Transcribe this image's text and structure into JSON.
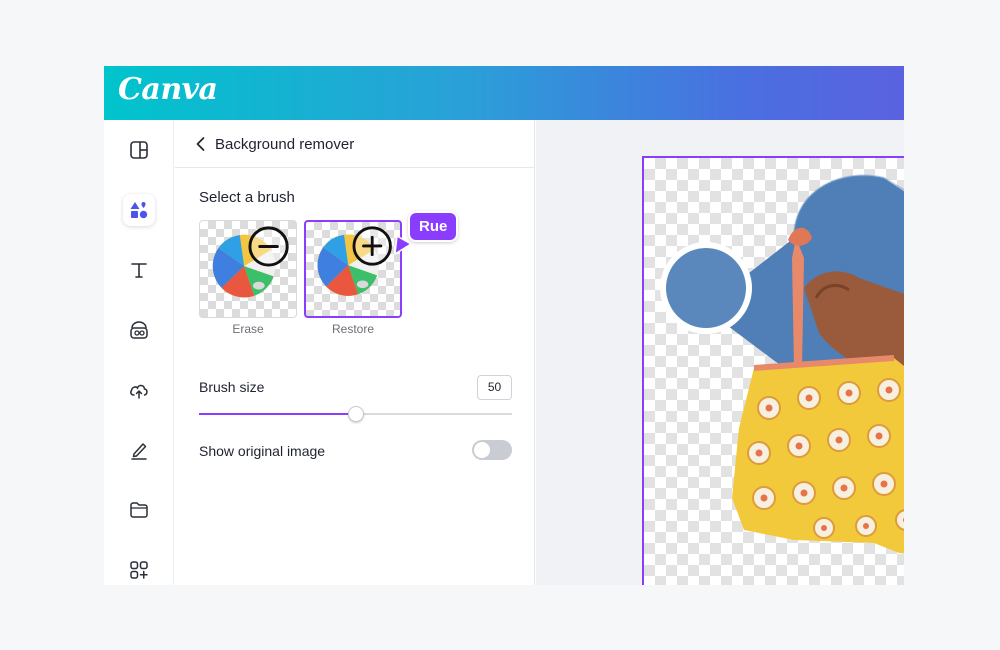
{
  "app": {
    "logo_text": "Canva",
    "accent": "#8b3dff",
    "gradient": [
      "#00c4cc",
      "#5a62e0"
    ]
  },
  "rail": {
    "items": [
      {
        "icon": "layout-icon"
      },
      {
        "icon": "elements-icon",
        "active": true
      },
      {
        "icon": "text-icon"
      },
      {
        "icon": "brand-icon"
      },
      {
        "icon": "upload-icon"
      },
      {
        "icon": "draw-icon"
      },
      {
        "icon": "folder-icon"
      },
      {
        "icon": "apps-icon"
      }
    ]
  },
  "panel": {
    "title": "Background remover",
    "select_brush_label": "Select a brush",
    "brushes": [
      {
        "label": "Erase",
        "icon": "minus-circle-icon",
        "selected": false
      },
      {
        "label": "Restore",
        "icon": "plus-circle-icon",
        "selected": true
      }
    ],
    "tooltip": "Rue",
    "brush_size_label": "Brush size",
    "brush_size_value": "50",
    "brush_size_fraction": 0.5,
    "show_original_label": "Show original image",
    "show_original_on": false
  }
}
